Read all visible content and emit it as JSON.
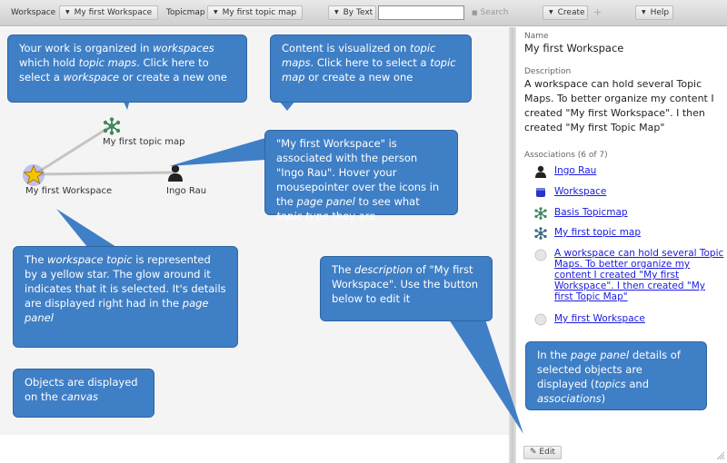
{
  "toolbar": {
    "workspace_label": "Workspace",
    "workspace_select": "My first Workspace",
    "topicmap_label": "Topicmap",
    "topicmap_select": "My first topic map",
    "search_mode": "By Text",
    "search_value": "",
    "search_button": "Search",
    "create_button": "Create",
    "help_button": "Help"
  },
  "canvas": {
    "nodes": {
      "topicmap": "My first topic map",
      "workspace": "My first Workspace",
      "person": "Ingo Rau"
    }
  },
  "bubbles": {
    "workspaces": "Your work is organized in <i>workspaces</i> which hold <i>topic maps</i>. Click here to select a <i>workspace</i> or create a new one",
    "topicmaps": "Content is visualized on <i>topic maps</i>. Click here to select a <i>topic map</i> or create a new one",
    "association": "\"My first Workspace\" is associated with the person \"Ingo Rau\". Hover your mousepointer over the icons in the <i>page panel</i> to see what <i>topic type</i> they are",
    "workspace_topic": "The <i>workspace topic</i> is represented by a yellow star. The glow around it indicates that it is selected. It's details are displayed right had in the <i>page panel</i>",
    "description": "The <i>description</i> of \"My first Workspace\". Use the button below to edit it",
    "canvas": "Objects are displayed on the <i>canvas</i>",
    "page_panel": "In the <i>page panel</i> details of selected objects are displayed (<i>topics</i> and <i>associations</i>)"
  },
  "panel": {
    "name_label": "Name",
    "name_value": "My first Workspace",
    "description_label": "Description",
    "description_value": "A workspace can hold several Topic Maps. To better organize my content I created \"My first Workspace\". I then created \"My first Topic Map\"",
    "associations_label": "Associations (6 of 7)",
    "associations": [
      {
        "icon": "person-icon",
        "label": "Ingo Rau"
      },
      {
        "icon": "workspace-icon",
        "label": "Workspace"
      },
      {
        "icon": "topicmap-icon",
        "label": "Basis Topicmap"
      },
      {
        "icon": "topicmap-icon",
        "label": "My first topic map"
      },
      {
        "icon": "note-icon",
        "label": "A workspace can hold several Topic Maps. To better organize my content I created \"My first Workspace\". I then created \"My first Topic Map\""
      },
      {
        "icon": "note-icon",
        "label": "My first Workspace"
      }
    ],
    "edit_button": "Edit"
  },
  "colors": {
    "bubble": "#3f7fc6",
    "link": "#1a1ae0",
    "canvas": "#f4f4f4",
    "star": "#f5c400"
  }
}
